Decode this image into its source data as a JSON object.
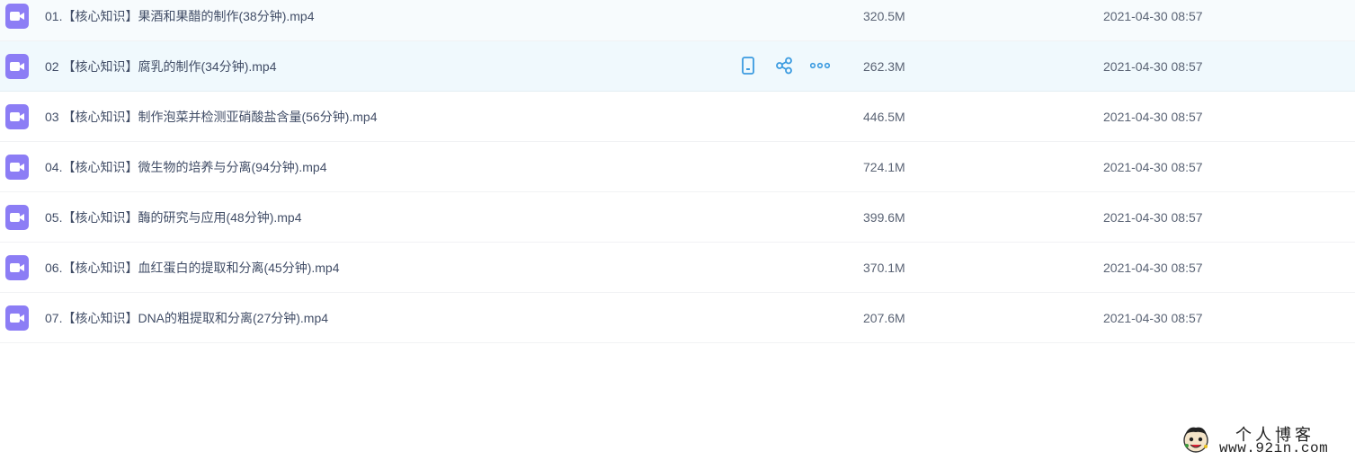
{
  "files": [
    {
      "name": "01.【核心知识】果酒和果醋的制作(38分钟).mp4",
      "size": "320.5M",
      "date": "2021-04-30 08:57",
      "icon": "video-file-icon"
    },
    {
      "name": "02 【核心知识】腐乳的制作(34分钟).mp4",
      "size": "262.3M",
      "date": "2021-04-30 08:57",
      "icon": "video-file-icon"
    },
    {
      "name": "03 【核心知识】制作泡菜并检测亚硝酸盐含量(56分钟).mp4",
      "size": "446.5M",
      "date": "2021-04-30 08:57",
      "icon": "video-file-icon"
    },
    {
      "name": "04.【核心知识】微生物的培养与分离(94分钟).mp4",
      "size": "724.1M",
      "date": "2021-04-30 08:57",
      "icon": "video-file-icon"
    },
    {
      "name": "05.【核心知识】酶的研究与应用(48分钟).mp4",
      "size": "399.6M",
      "date": "2021-04-30 08:57",
      "icon": "video-file-icon"
    },
    {
      "name": "06.【核心知识】血红蛋白的提取和分离(45分钟).mp4",
      "size": "370.1M",
      "date": "2021-04-30 08:57",
      "icon": "video-file-icon"
    },
    {
      "name": "07.【核心知识】DNA的粗提取和分离(27分钟).mp4",
      "size": "207.6M",
      "date": "2021-04-30 08:57",
      "icon": "video-file-icon"
    }
  ],
  "hovered_row_index": 1,
  "row_actions": [
    {
      "icon": "phone-icon"
    },
    {
      "icon": "share-icon"
    },
    {
      "icon": "more-icon"
    }
  ],
  "watermark": {
    "title": "个人博客",
    "url": "www.92in.com"
  },
  "colors": {
    "video_icon": "#8c7df5",
    "action_icon": "#3b9be0",
    "text": "#424e67",
    "hover_row": "#f0f9fd"
  }
}
